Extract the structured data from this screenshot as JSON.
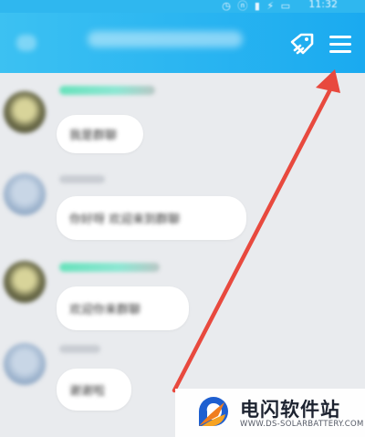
{
  "status_bar": {
    "time": "11:32",
    "icons": "◷ ⓝ ▮ ⚡ ▭"
  },
  "header": {
    "back_icon": "back-icon",
    "tag_icon": "tag-icon",
    "menu_icon": "menu-icon",
    "background": "#1aaaf0"
  },
  "messages": [
    {
      "avatar": "olive",
      "name_style": "green",
      "text": "我是群聊"
    },
    {
      "avatar": "blue",
      "name_style": "grey",
      "text": "你好呀 欢迎来到群聊"
    },
    {
      "avatar": "olive",
      "name_style": "green",
      "text": "欢迎你来群聊"
    },
    {
      "avatar": "blue",
      "name_style": "grey",
      "text": "谢谢啦"
    }
  ],
  "annotation": {
    "arrow_color": "#e8493e"
  },
  "watermark": {
    "name": "电闪软件站",
    "url": "WWW.DS-SOLARBATTERY.COM"
  }
}
